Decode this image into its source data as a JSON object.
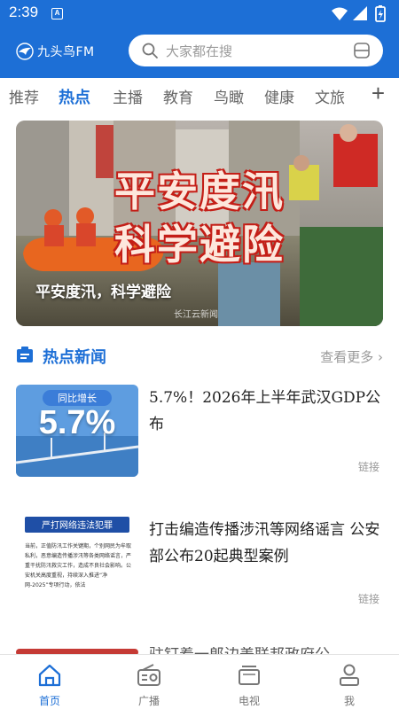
{
  "status": {
    "time": "2:39",
    "sim_label": "A"
  },
  "header": {
    "brand": "九头鸟FM",
    "search_placeholder": "大家都在搜"
  },
  "tabs": [
    {
      "label": "推荐",
      "active": false
    },
    {
      "label": "热点",
      "active": true
    },
    {
      "label": "主播",
      "active": false
    },
    {
      "label": "教育",
      "active": false
    },
    {
      "label": "鸟瞰",
      "active": false
    },
    {
      "label": "健康",
      "active": false
    },
    {
      "label": "文旅",
      "active": false
    }
  ],
  "tab_add": "+",
  "banner": {
    "headline_1": "平安度汛",
    "headline_2": "科学避险",
    "caption": "平安度汛，科学避险",
    "watermark": "长江云新闻"
  },
  "section": {
    "title": "热点新闻",
    "more": "查看更多"
  },
  "news": [
    {
      "title": "5.7%！2026年上半年武汉GDP公布",
      "link": "链接",
      "thumb_label": "同比增长",
      "thumb_value": "5.7%"
    },
    {
      "title": "打击编造传播涉汛等网络谣言 公安部公布20起典型案例",
      "link": "链接",
      "thumb_heading": "严打网络违法犯罪",
      "thumb_text": "当前，正值防汛工作关键期，个别网民为牟取私利，恶意编造传播涉汛等各类网络谣言，严重干扰防汛救灾工作，造成不良社会影响。公安机关高度重视，持续深入推进“净网-2025”专项行动，依法"
    },
    {
      "title": "驻钉着一郎边美联邦政府公",
      "link": ""
    }
  ],
  "bottom_nav": [
    {
      "label": "首页",
      "icon": "home-icon",
      "active": true
    },
    {
      "label": "广播",
      "icon": "radio-icon",
      "active": false
    },
    {
      "label": "电视",
      "icon": "tv-icon",
      "active": false
    },
    {
      "label": "我",
      "icon": "profile-icon",
      "active": false
    }
  ],
  "colors": {
    "brand_blue": "#1d6fd6",
    "banner_red": "#c41e17",
    "muted": "#999999"
  }
}
